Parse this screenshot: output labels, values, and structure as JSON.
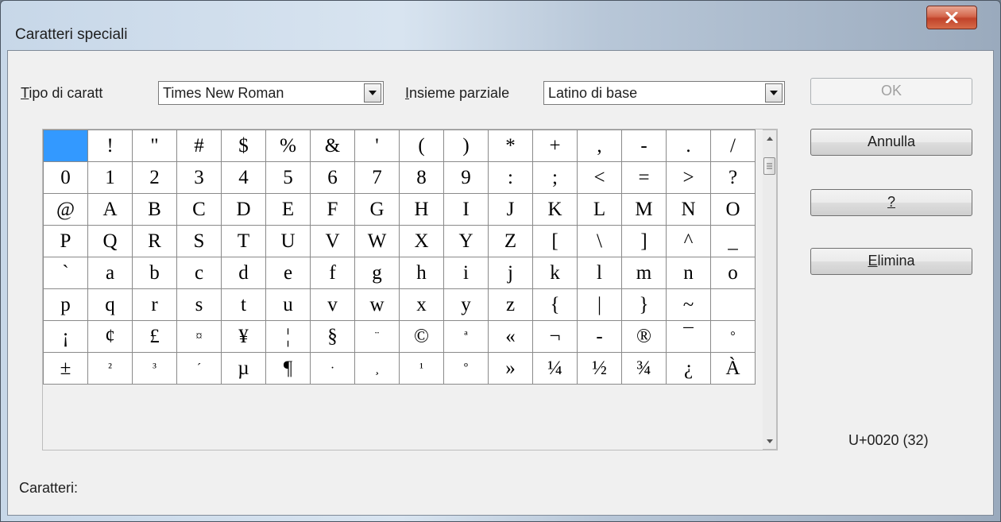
{
  "window": {
    "title": "Caratteri speciali"
  },
  "font_field": {
    "label_prefix": "T",
    "label_rest": "ipo di caratt",
    "value": "Times New Roman"
  },
  "subset_field": {
    "label_prefix": "I",
    "label_rest": "nsieme parziale",
    "value": "Latino di base"
  },
  "buttons": {
    "ok": "OK",
    "cancel": "Annulla",
    "help": "?",
    "delete_prefix": "E",
    "delete_rest": "limina"
  },
  "char_grid": [
    [
      " ",
      "!",
      "\"",
      "#",
      "$",
      "%",
      "&",
      "'",
      "(",
      ")",
      "*",
      "+",
      ",",
      "-",
      ".",
      "/"
    ],
    [
      "0",
      "1",
      "2",
      "3",
      "4",
      "5",
      "6",
      "7",
      "8",
      "9",
      ":",
      ";",
      "<",
      "=",
      ">",
      "?"
    ],
    [
      "@",
      "A",
      "B",
      "C",
      "D",
      "E",
      "F",
      "G",
      "H",
      "I",
      "J",
      "K",
      "L",
      "M",
      "N",
      "O"
    ],
    [
      "P",
      "Q",
      "R",
      "S",
      "T",
      "U",
      "V",
      "W",
      "X",
      "Y",
      "Z",
      "[",
      "\\",
      "]",
      "^",
      "_"
    ],
    [
      "`",
      "a",
      "b",
      "c",
      "d",
      "e",
      "f",
      "g",
      "h",
      "i",
      "j",
      "k",
      "l",
      "m",
      "n",
      "o"
    ],
    [
      "p",
      "q",
      "r",
      "s",
      "t",
      "u",
      "v",
      "w",
      "x",
      "y",
      "z",
      "{",
      "|",
      "}",
      "~",
      ""
    ],
    [
      "¡",
      "¢",
      "£",
      "¤",
      "¥",
      "¦",
      "§",
      "¨",
      "©",
      "ª",
      "«",
      "¬",
      "-",
      "®",
      "¯",
      "°"
    ],
    [
      "±",
      "²",
      "³",
      "´",
      "µ",
      "¶",
      "·",
      "¸",
      "¹",
      "º",
      "»",
      "¼",
      "½",
      "¾",
      "¿",
      "À"
    ]
  ],
  "selected_char_code": "U+0020 (32)",
  "characters_label": "Caratteri:",
  "colors": {
    "selection": "#3399ff",
    "close_button": "#c7452b"
  }
}
